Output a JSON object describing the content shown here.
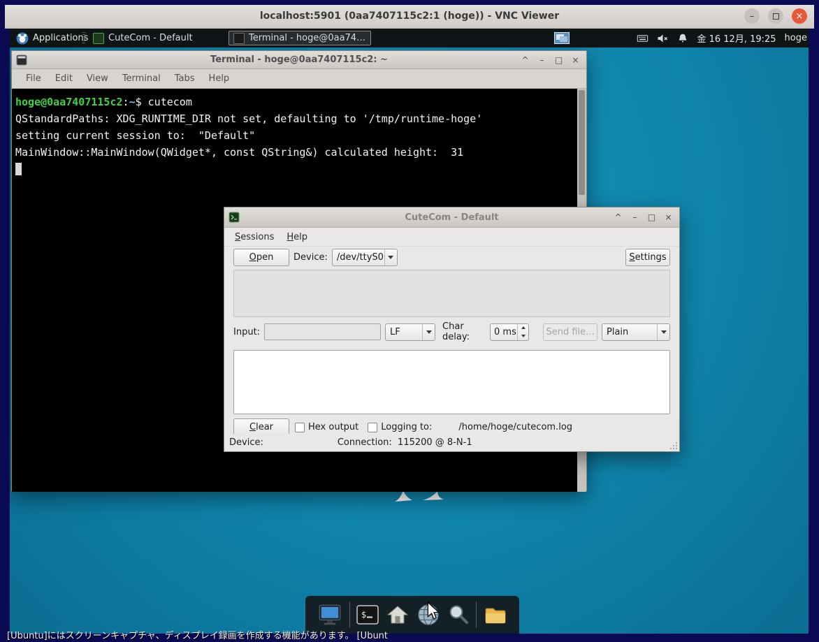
{
  "vnc": {
    "title": "localhost:5901 (0aa7407115c2:1 (hoge)) - VNC Viewer"
  },
  "panel": {
    "applications_label": "Applications",
    "tasks": [
      {
        "label": "CuteCom - Default"
      },
      {
        "label": "Terminal - hoge@0aa74…"
      }
    ],
    "clock": "金 16 12月, 19:25",
    "user": "hoge"
  },
  "terminal_window": {
    "title": "Terminal - hoge@0aa7407115c2: ~",
    "menus": [
      "File",
      "Edit",
      "View",
      "Terminal",
      "Tabs",
      "Help"
    ],
    "prompt_user": "hoge@0aa7407115c2",
    "prompt_colon": ":",
    "prompt_path": "~",
    "prompt_dollar": "$ ",
    "command": "cutecom",
    "output_lines": [
      "QStandardPaths: XDG_RUNTIME_DIR not set, defaulting to '/tmp/runtime-hoge'",
      "setting current session to:  \"Default\"",
      "MainWindow::MainWindow(QWidget*, const QString&) calculated height:  31"
    ]
  },
  "cutecom": {
    "title": "CuteCom - Default",
    "menus": [
      "Sessions",
      "Help"
    ],
    "open_button": "Open",
    "device_label": "Device:",
    "device_value": "/dev/ttyS0",
    "settings_button": "Settings",
    "input_label": "Input:",
    "input_value": "",
    "eol_value": "LF",
    "char_delay_label": "Char delay:",
    "char_delay_value": "0 ms",
    "send_file_button": "Send file...",
    "format_value": "Plain",
    "clear_button": "Clear",
    "hex_output_label": "Hex output",
    "logging_label": "Logging to:",
    "logging_path": "/home/hoge/cutecom.log",
    "status_device_label": "Device:",
    "status_connection": "Connection:  115200 @ 8-N-1"
  },
  "icons": {
    "shade": "^",
    "minimize": "–",
    "maximize": "□",
    "close": "×"
  },
  "colors": {
    "desktop_teal": "#0f83aa",
    "close_button": "#e8593c",
    "prompt_green": "#3fd23f"
  },
  "subtitle": "[Ubuntu]にはスクリーンキャプチャ、ディスプレイ録画を作成する機能があります。 [Ubunt"
}
